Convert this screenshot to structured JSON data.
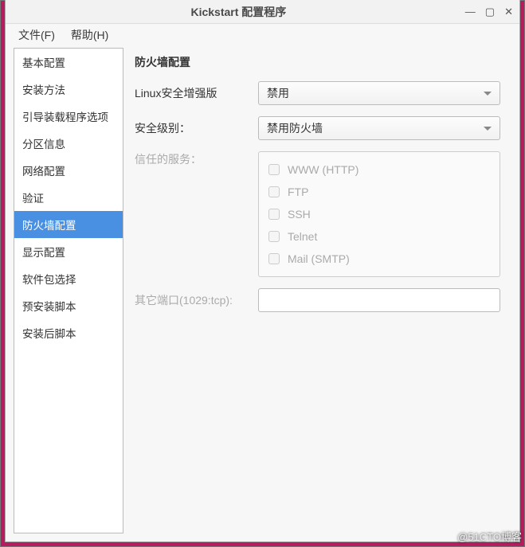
{
  "window": {
    "title": "Kickstart 配置程序"
  },
  "menu": {
    "file": "文件(F)",
    "help": "帮助(H)"
  },
  "sidebar": {
    "items": [
      {
        "label": "基本配置"
      },
      {
        "label": "安装方法"
      },
      {
        "label": "引导装载程序选项"
      },
      {
        "label": "分区信息"
      },
      {
        "label": "网络配置"
      },
      {
        "label": "验证"
      },
      {
        "label": "防火墙配置"
      },
      {
        "label": "显示配置"
      },
      {
        "label": "软件包选择"
      },
      {
        "label": "预安装脚本"
      },
      {
        "label": "安装后脚本"
      }
    ],
    "active_index": 6
  },
  "main": {
    "section_title": "防火墙配置",
    "selinux_label": "Linux安全增强版",
    "selinux_value": "禁用",
    "security_level_label": "安全级别：",
    "security_level_value": "禁用防火墙",
    "trusted_label": "信任的服务：",
    "services": [
      {
        "label": "WWW (HTTP)"
      },
      {
        "label": "FTP"
      },
      {
        "label": "SSH"
      },
      {
        "label": "Telnet"
      },
      {
        "label": "Mail (SMTP)"
      }
    ],
    "other_ports_label": "其它端口(1029:tcp):",
    "other_ports_value": ""
  },
  "watermark": "@51CTO博客"
}
